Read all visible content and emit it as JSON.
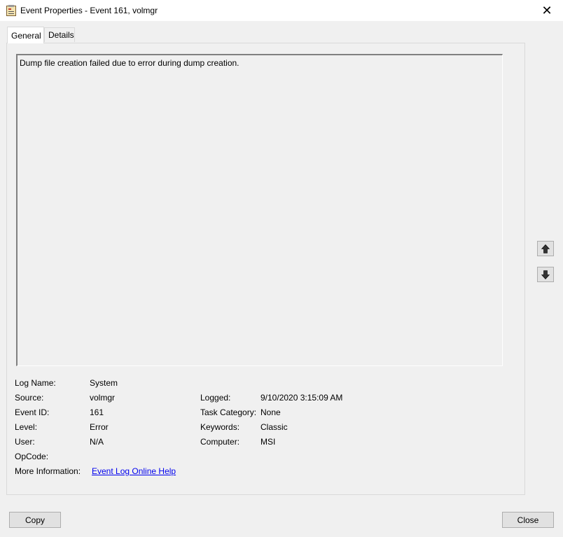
{
  "window": {
    "title": "Event Properties - Event 161, volmgr",
    "close_glyph": "✕"
  },
  "tabs": [
    {
      "label": "General",
      "active": true
    },
    {
      "label": "Details",
      "active": false
    }
  ],
  "description": "Dump file creation failed due to error during dump creation.",
  "fields": {
    "log_name": {
      "label": "Log Name:",
      "value": "System"
    },
    "source": {
      "label": "Source:",
      "value": "volmgr"
    },
    "logged": {
      "label": "Logged:",
      "value": "9/10/2020 3:15:09 AM"
    },
    "event_id": {
      "label": "Event ID:",
      "value": "161"
    },
    "task_category": {
      "label": "Task Category:",
      "value": "None"
    },
    "level": {
      "label": "Level:",
      "value": "Error"
    },
    "keywords": {
      "label": "Keywords:",
      "value": "Classic"
    },
    "user": {
      "label": "User:",
      "value": "N/A"
    },
    "computer": {
      "label": "Computer:",
      "value": "MSI"
    },
    "opcode": {
      "label": "OpCode:",
      "value": ""
    },
    "more_info": {
      "label": "More Information:",
      "value": "Event Log Online Help"
    }
  },
  "buttons": {
    "copy": "Copy",
    "close": "Close"
  },
  "icons": {
    "app": "event-viewer-icon",
    "up": "arrow-up-icon",
    "down": "arrow-down-icon"
  }
}
